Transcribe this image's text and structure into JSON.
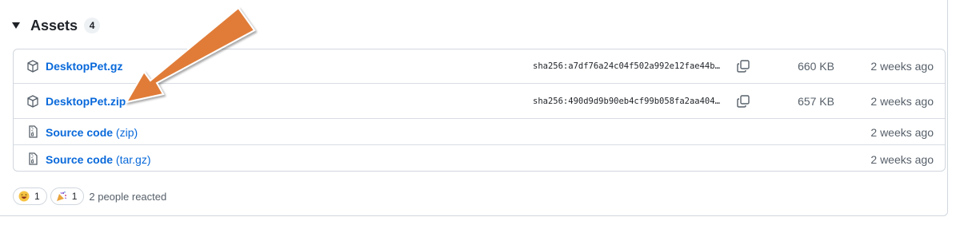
{
  "assets": {
    "title": "Assets",
    "count": "4",
    "rows": [
      {
        "name": "DesktopPet.gz",
        "sha": "sha256:a7df76a24c04f502a992e12fae44b…",
        "size": "660 KB",
        "date": "2 weeks ago",
        "icon": "package-icon"
      },
      {
        "name": "DesktopPet.zip",
        "sha": "sha256:490d9d9b90eb4cf99b058fa2aa404…",
        "size": "657 KB",
        "date": "2 weeks ago",
        "icon": "package-icon"
      },
      {
        "name": "Source code",
        "suffix": "(zip)",
        "date": "2 weeks ago",
        "icon": "file-zip-icon"
      },
      {
        "name": "Source code",
        "suffix": "(tar.gz)",
        "date": "2 weeks ago",
        "icon": "file-zip-icon"
      }
    ]
  },
  "reactions": {
    "items": [
      {
        "emoji": "laugh-emoji",
        "count": "1"
      },
      {
        "emoji": "tada-emoji",
        "count": "1"
      }
    ],
    "summary": "2 people reacted"
  },
  "colors": {
    "link": "#0969da",
    "muted": "#57606a",
    "border": "#d0d7de",
    "arrow": "#e07b39"
  }
}
